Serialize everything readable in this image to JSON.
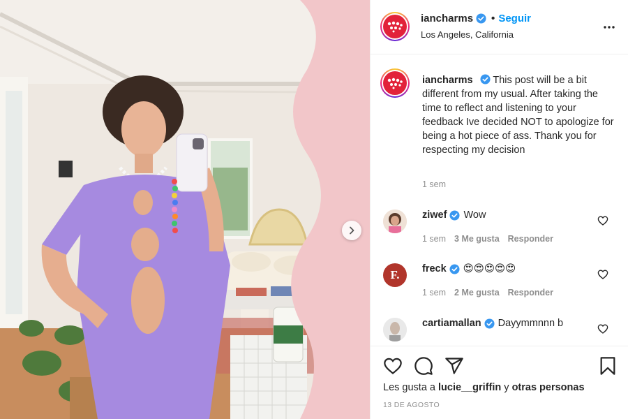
{
  "post": {
    "author": "iancharms",
    "follow_label": "Seguir",
    "separator": "•",
    "location": "Los Angeles, California"
  },
  "caption": {
    "username": "iancharms",
    "text": "This post will be a bit different from my usual. After taking the time to reflect and listening to your feedback Ive decided NOT to apologize for being a hot piece of ass. Thank you for respecting my decision",
    "time": "1 sem"
  },
  "comments": [
    {
      "username": "ziwef",
      "verified": true,
      "text": "Wow",
      "time": "1 sem",
      "likes": "3 Me gusta",
      "reply": "Responder"
    },
    {
      "username": "freck",
      "verified": true,
      "text": "😍😍😍😍😍",
      "time": "1 sem",
      "likes": "2 Me gusta",
      "reply": "Responder",
      "avatar_letter": "F."
    },
    {
      "username": "cartiamallan",
      "verified": true,
      "text": "Dayymmnnn b"
    }
  ],
  "likes_line": {
    "prefix": "Les gusta a ",
    "user": "lucie__griffin",
    "middle": " y ",
    "suffix": "otras personas"
  },
  "date": "13 DE AGOSTO",
  "colors": {
    "accent": "#0095f6",
    "verified": "#3897f0",
    "brand_avatar": "#e2223a",
    "dress": "#a68ae0",
    "wavy_frame": "#f2c6c9"
  },
  "icons": [
    "more-icon",
    "verified-icon",
    "heart-icon",
    "comment-icon",
    "share-icon",
    "bookmark-icon",
    "chevron-right-icon"
  ]
}
